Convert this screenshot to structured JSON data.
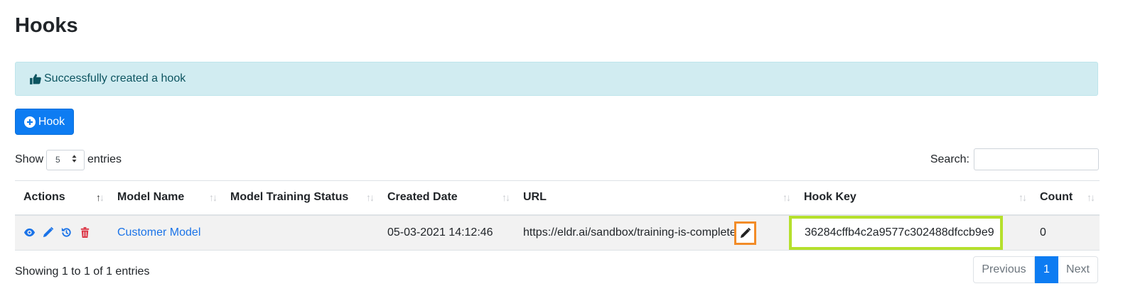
{
  "page": {
    "title": "Hooks"
  },
  "alert": {
    "message": "Successfully created a hook",
    "icon": "thumbs-up-icon"
  },
  "toolbar": {
    "add_label": "Hook",
    "add_icon": "plus-circle-icon"
  },
  "length": {
    "prefix": "Show",
    "value": "5",
    "suffix": "entries"
  },
  "search": {
    "label": "Search:",
    "value": ""
  },
  "table": {
    "columns": [
      "Actions",
      "Model Name",
      "Model Training Status",
      "Created Date",
      "URL",
      "Hook Key",
      "Count"
    ],
    "rows": [
      {
        "model_name": "Customer Model",
        "training_status": "",
        "created_date": "05-03-2021 14:12:46",
        "url": "https://eldr.ai/sandbox/training-is-complete",
        "hook_key": "36284cffb4c2a9577c302488dfccb9e9",
        "count": "0"
      }
    ]
  },
  "footer": {
    "info": "Showing 1 to 1 of 1 entries"
  },
  "pagination": {
    "previous": "Previous",
    "current": "1",
    "next": "Next"
  },
  "colors": {
    "primary": "#0d7cf2",
    "alert_bg": "#d1ecf1",
    "danger_icon": "#dc3545",
    "highlight_orange": "#f28c28",
    "highlight_green": "#b5e02c"
  }
}
